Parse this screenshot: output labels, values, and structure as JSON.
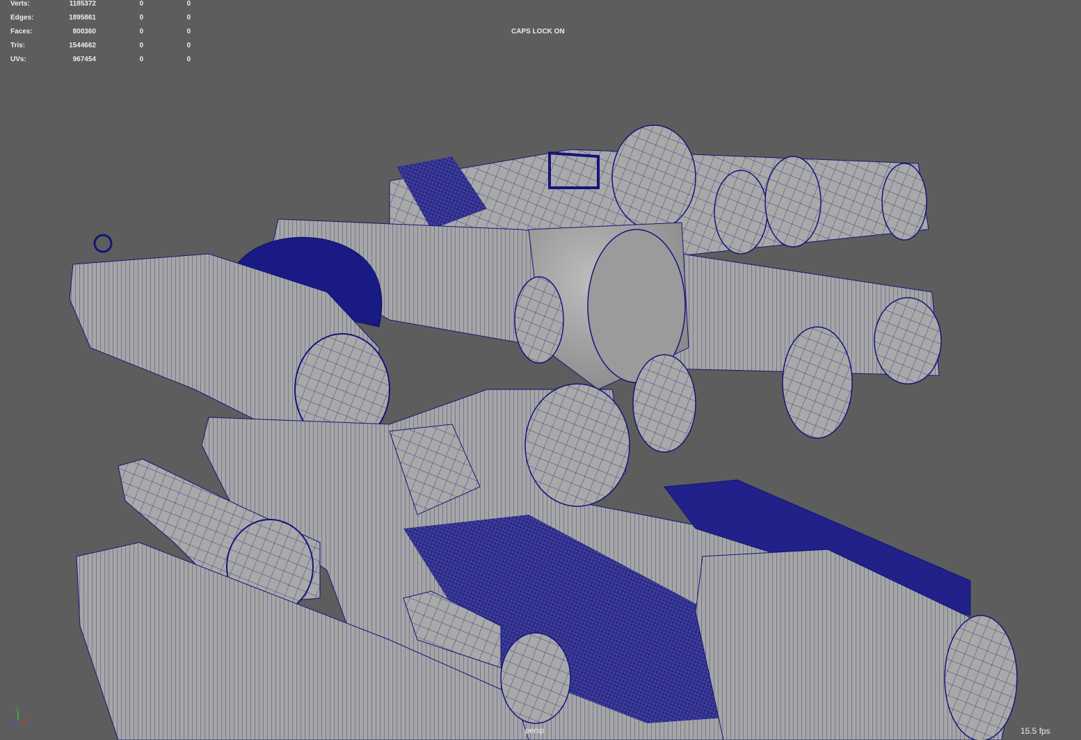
{
  "hud": {
    "rows": [
      {
        "label": "Verts:",
        "total": "1185372",
        "selected": "0",
        "component": "0"
      },
      {
        "label": "Edges:",
        "total": "1895861",
        "selected": "0",
        "component": "0"
      },
      {
        "label": "Faces:",
        "total": "800360",
        "selected": "0",
        "component": "0"
      },
      {
        "label": "Tris:",
        "total": "1544662",
        "selected": "0",
        "component": "0"
      },
      {
        "label": "UVs:",
        "total": "967454",
        "selected": "0",
        "component": "0"
      }
    ],
    "caps_lock": "CAPS LOCK ON",
    "camera": "persp",
    "fps": "15.5 fps"
  },
  "axis_gizmo": {
    "x": "x",
    "y": "y",
    "z": "z"
  },
  "colors": {
    "background": "#5d5d5d",
    "mesh_fill": "#a7a7a7",
    "mesh_shadow": "#7a7a7a",
    "wireframe": "#14147a",
    "selected_dense": "#1c1c86",
    "hud_text": "#ececec",
    "axis_x": "#d03030",
    "axis_y": "#30c030",
    "axis_z": "#3050e0"
  }
}
